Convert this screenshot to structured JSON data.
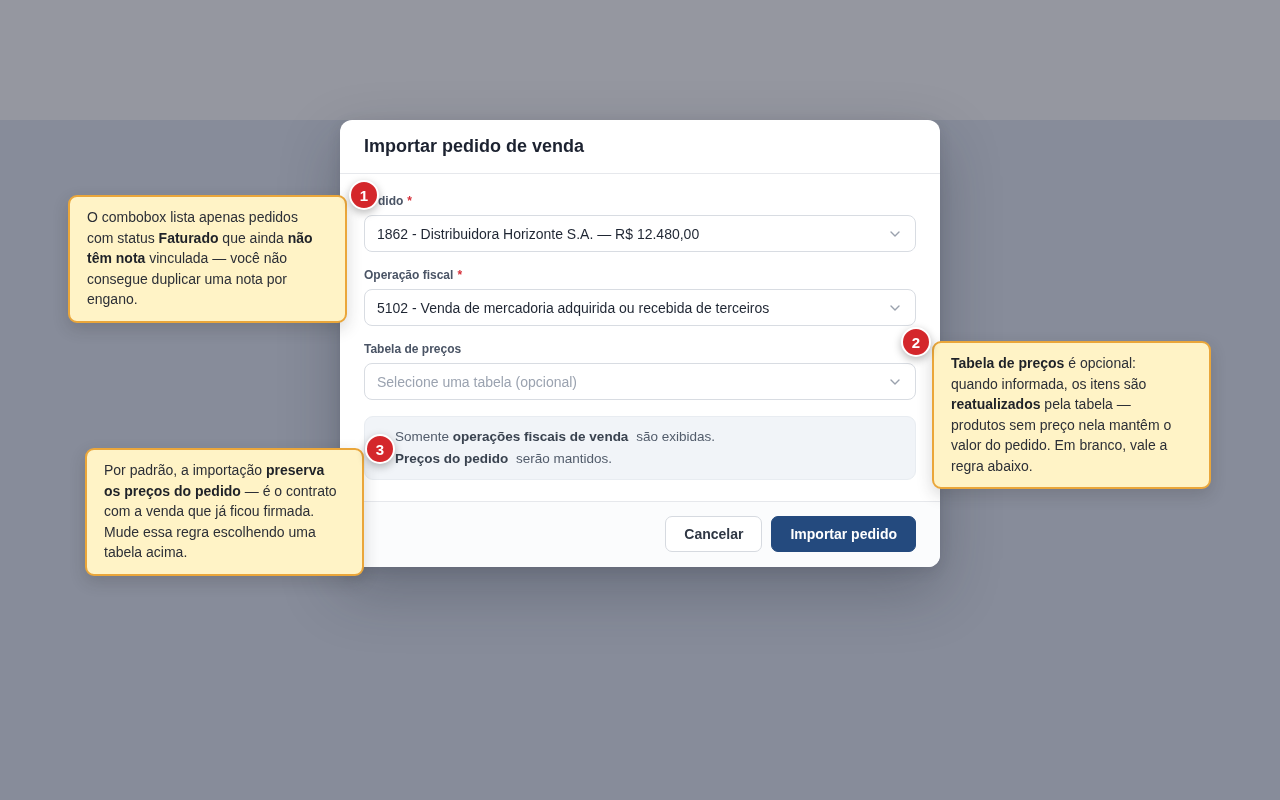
{
  "dialog": {
    "title": "Importar pedido de venda",
    "fields": [
      {
        "label": "dido",
        "required_mark": "*",
        "value": "1862 - Distribuidora Horizonte S.A. — R$ 12.480,00"
      },
      {
        "label": "Operação fiscal",
        "required_mark": "*",
        "value": "5102 - Venda de mercadoria adquirida ou recebida de terceiros"
      },
      {
        "label": "Tabela de preços",
        "placeholder": "Selecione uma tabela (opcional)"
      }
    ],
    "info_lines": [
      "Somente **operações fiscais de venda** são exibidas.",
      "**Preços do pedido** serão mantidos."
    ],
    "buttons": [
      {
        "label": "Cancelar",
        "kind": "secondary"
      },
      {
        "label": "Importar pedido",
        "kind": "primary"
      }
    ]
  },
  "annotations": [
    {
      "number": "1",
      "text": "O combobox lista apenas pedidos com status **Faturado** que ainda **não têm nota** vinculada — você não consegue duplicar uma nota por engano."
    },
    {
      "number": "2",
      "text": "**Tabela de preços** é opcional: quando informada, os itens são **reatualizados** pela tabela — produtos sem preço nela mantêm o valor do pedido. Em branco, vale a regra abaixo."
    },
    {
      "number": "3",
      "text": "Por padrão, a importação **preserva os preços do pedido** — é o contrato com a venda que já ficou firmada. Mude essa regra escolhendo uma tabela acima."
    }
  ]
}
